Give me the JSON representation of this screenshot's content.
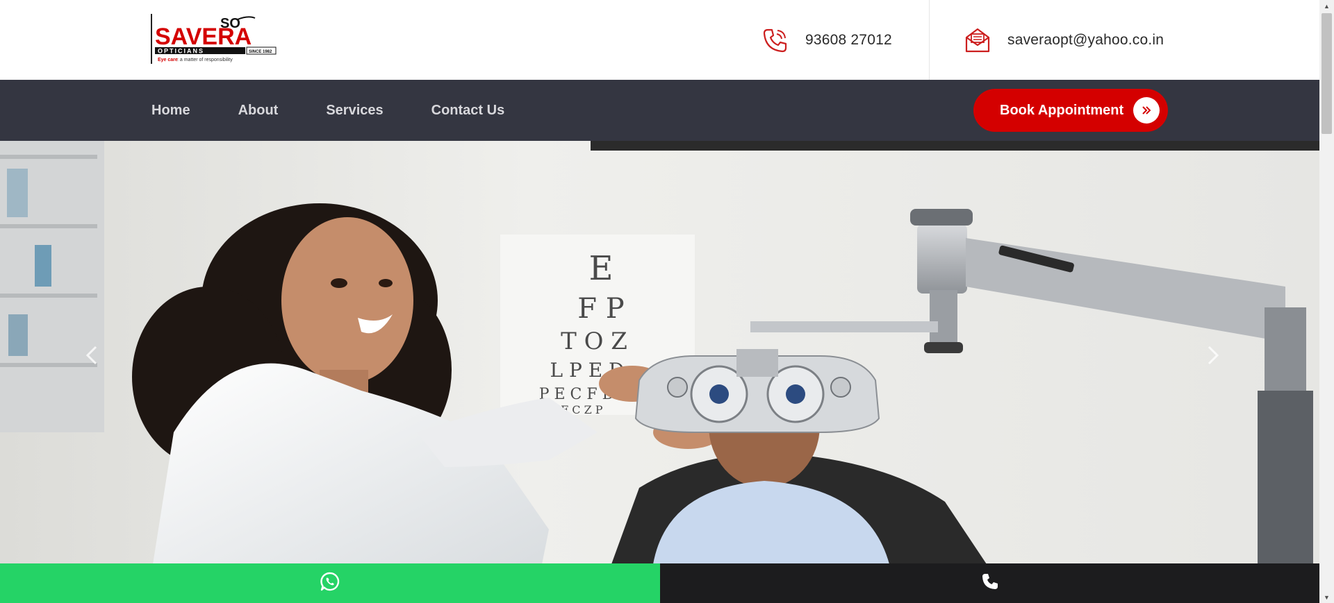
{
  "brand": {
    "logo_text_top": "SO",
    "logo_text_main": "SAVERA",
    "logo_text_sub": "OPTICIANS",
    "logo_since": "SINCE 1982",
    "logo_tagline_red": "Eye care",
    "logo_tagline_rest": " : a matter of responsibility",
    "accent_color": "#d40000"
  },
  "header": {
    "phone": "93608 27012",
    "phone_icon": "phone-icon",
    "email": "saveraopt@yahoo.co.in",
    "email_icon": "envelope-icon"
  },
  "nav": {
    "items": [
      {
        "label": "Home"
      },
      {
        "label": "About"
      },
      {
        "label": "Services"
      },
      {
        "label": "Contact Us"
      }
    ],
    "cta_label": "Book Appointment",
    "cta_icon": "double-chevron-right-icon",
    "bg_color": "#343641"
  },
  "hero": {
    "chart_letters": [
      "E",
      "F P",
      "T O Z",
      "L P E D",
      "P E C F D",
      "E D F C Z P"
    ],
    "prev_icon": "chevron-left-icon",
    "next_icon": "chevron-right-icon"
  },
  "bottom_bar": {
    "whatsapp_icon": "whatsapp-icon",
    "whatsapp_color": "#25d366",
    "call_icon": "phone-icon",
    "call_color": "#1c1c1e"
  }
}
